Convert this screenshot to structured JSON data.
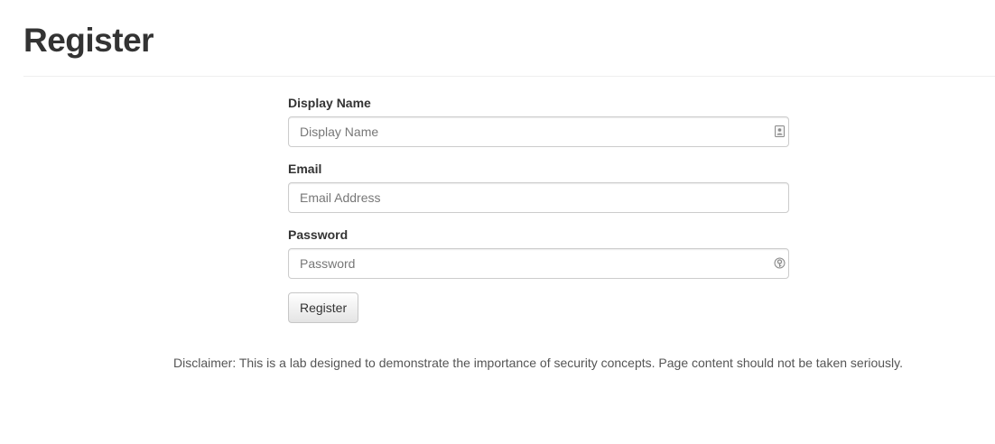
{
  "header": {
    "title": "Register"
  },
  "form": {
    "display_name": {
      "label": "Display Name",
      "placeholder": "Display Name",
      "value": "",
      "icon": "contact-card-icon"
    },
    "email": {
      "label": "Email",
      "placeholder": "Email Address",
      "value": ""
    },
    "password": {
      "label": "Password",
      "placeholder": "Password",
      "value": "",
      "icon": "password-key-icon"
    },
    "submit_label": "Register"
  },
  "footer": {
    "disclaimer": "Disclaimer: This is a lab designed to demonstrate the importance of security concepts. Page content should not be taken seriously."
  }
}
